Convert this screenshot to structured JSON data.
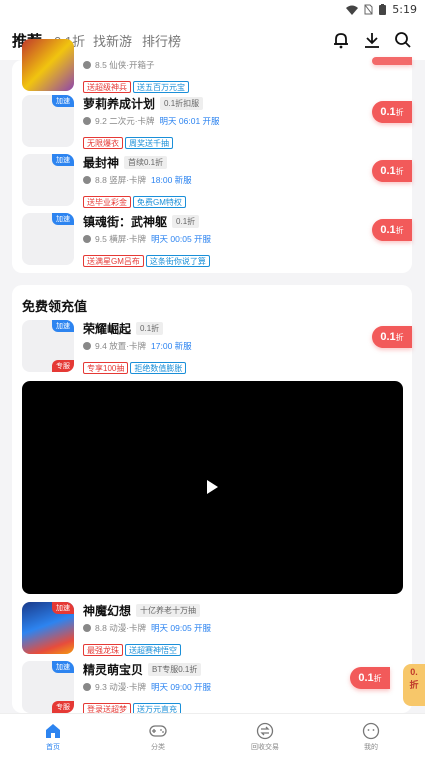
{
  "status_bar": {
    "time": "5:19"
  },
  "top_nav": {
    "tabs": [
      "推荐",
      "0.1折",
      "找新游",
      "排行榜"
    ],
    "active_tab": "推荐"
  },
  "list_top": {
    "partial_game": {
      "rating": "8.5",
      "genre": "仙侠·开箱子",
      "promos": [
        "送超级神兵",
        "送五百万元宝"
      ]
    },
    "games": [
      {
        "name": "萝莉养成计划",
        "tag": "0.1折扣服",
        "rating": "9.2",
        "genre": "二次元·卡牌",
        "launch": "明天 06:01 开服",
        "promos": [
          "无限爆衣",
          "周奖送千抽"
        ],
        "badge": "加速",
        "discount": "0.1",
        "discount_unit": "折"
      },
      {
        "name": "最封神",
        "tag": "首续0.1折",
        "rating": "8.8",
        "genre": "竖屏·卡牌",
        "launch": "18:00 新服",
        "promos": [
          "送毕业彩金",
          "免费GM特权"
        ],
        "badge": "加速",
        "discount": "0.1",
        "discount_unit": "折"
      },
      {
        "name": "镇魂街：武神躯",
        "tag": "0.1折",
        "rating": "9.5",
        "genre": "横屏·卡牌",
        "launch": "明天 00:05 开服",
        "promos": [
          "送满星GM吕布",
          "这条街你说了算"
        ],
        "badge": "加速",
        "discount": "0.1",
        "discount_unit": "折"
      }
    ]
  },
  "free_recharge": {
    "title": "免费领充值",
    "game": {
      "name": "荣耀崛起",
      "tag": "0.1折",
      "rating": "9.4",
      "genre": "放置·卡牌",
      "launch": "17:00 新服",
      "promos": [
        "专享100抽",
        "拒绝数值膨胀"
      ],
      "badge": "加速",
      "badge2": "专服",
      "discount": "0.1",
      "discount_unit": "折"
    }
  },
  "list_bottom": [
    {
      "name": "神魔幻想",
      "tag": "十亿养老十万抽",
      "rating": "8.8",
      "genre": "动漫·卡牌",
      "launch": "明天 09:05 开服",
      "promos": [
        "最强龙珠",
        "送超赛神悟空"
      ],
      "badge": "加速",
      "discount": "0.1",
      "discount_unit": "折"
    },
    {
      "name": "精灵萌宝贝",
      "tag": "BT专服0.1折",
      "rating": "9.3",
      "genre": "动漫·卡牌",
      "launch": "明天 09:00 开服",
      "promos": [
        "登录送超梦",
        "送万元直充"
      ],
      "badge": "加速",
      "badge2": "专服",
      "discount": "0.1",
      "discount_unit": "折"
    }
  ],
  "float_ad": {
    "line1": "0.",
    "line2": "折"
  },
  "bottom_tabs": [
    "首页",
    "分类",
    "回收交易",
    "我的"
  ],
  "colors": {
    "accent": "#2d84f0",
    "discount": "#f25a5a",
    "promo_red": "#e53935",
    "promo_blue": "#1a8fd8"
  }
}
